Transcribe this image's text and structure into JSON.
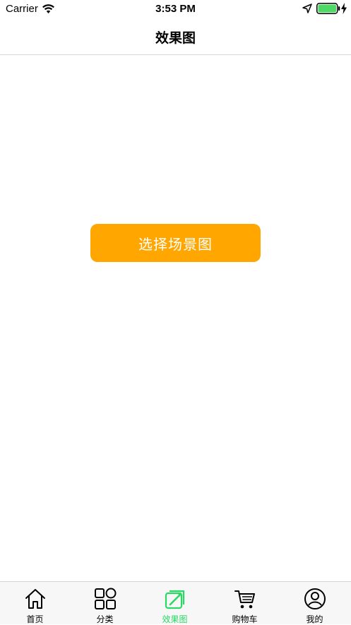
{
  "status_bar": {
    "carrier": "Carrier",
    "time": "3:53 PM"
  },
  "nav": {
    "title": "效果图"
  },
  "main": {
    "select_scene_label": "选择场景图"
  },
  "tabs": [
    {
      "label": "首页",
      "icon": "home-icon",
      "active": false
    },
    {
      "label": "分类",
      "icon": "category-grid-icon",
      "active": false
    },
    {
      "label": "效果图",
      "icon": "rendering-icon",
      "active": true
    },
    {
      "label": "购物车",
      "icon": "cart-icon",
      "active": false
    },
    {
      "label": "我的",
      "icon": "user-icon",
      "active": false
    }
  ],
  "colors": {
    "accent_button": "#ffa600",
    "tab_active": "#2bd866",
    "battery": "#4cd964"
  }
}
